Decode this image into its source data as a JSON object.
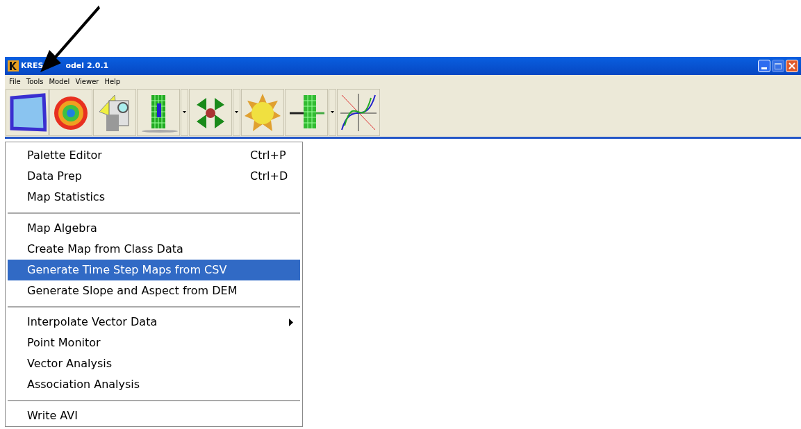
{
  "window": {
    "title_parts": [
      "KRES",
      "odel 2.0.1"
    ]
  },
  "menu_bar": [
    "File",
    "Tools",
    "Model",
    "Viewer",
    "Help"
  ],
  "toolbar": [
    {
      "kind": "screen",
      "dropdown": false
    },
    {
      "kind": "swirl",
      "dropdown": false
    },
    {
      "kind": "calc",
      "dropdown": false
    },
    {
      "kind": "grid",
      "dropdown": true
    },
    {
      "kind": "arrows",
      "dropdown": true
    },
    {
      "kind": "sun",
      "dropdown": false
    },
    {
      "kind": "gridline",
      "dropdown": true
    },
    {
      "kind": "curves",
      "dropdown": false
    }
  ],
  "tools_menu": [
    [
      {
        "label": "Palette Editor",
        "shortcut": "Ctrl+P",
        "selected": false,
        "submenu": false
      },
      {
        "label": "Data Prep",
        "shortcut": "Ctrl+D",
        "selected": false,
        "submenu": false
      },
      {
        "label": "Map Statistics",
        "selected": false,
        "submenu": false
      }
    ],
    [
      {
        "label": "Map Algebra",
        "selected": false,
        "submenu": false
      },
      {
        "label": "Create Map from Class Data",
        "selected": false,
        "submenu": false
      },
      {
        "label": "Generate Time Step Maps from CSV",
        "selected": true,
        "submenu": false
      },
      {
        "label": "Generate Slope and Aspect from DEM",
        "selected": false,
        "submenu": false
      }
    ],
    [
      {
        "label": "Interpolate Vector Data",
        "selected": false,
        "submenu": true
      },
      {
        "label": "Point Monitor",
        "selected": false,
        "submenu": false
      },
      {
        "label": "Vector Analysis",
        "selected": false,
        "submenu": false
      },
      {
        "label": "Association Analysis",
        "selected": false,
        "submenu": false
      }
    ],
    [
      {
        "label": "Write AVI",
        "selected": false,
        "submenu": false
      }
    ]
  ]
}
